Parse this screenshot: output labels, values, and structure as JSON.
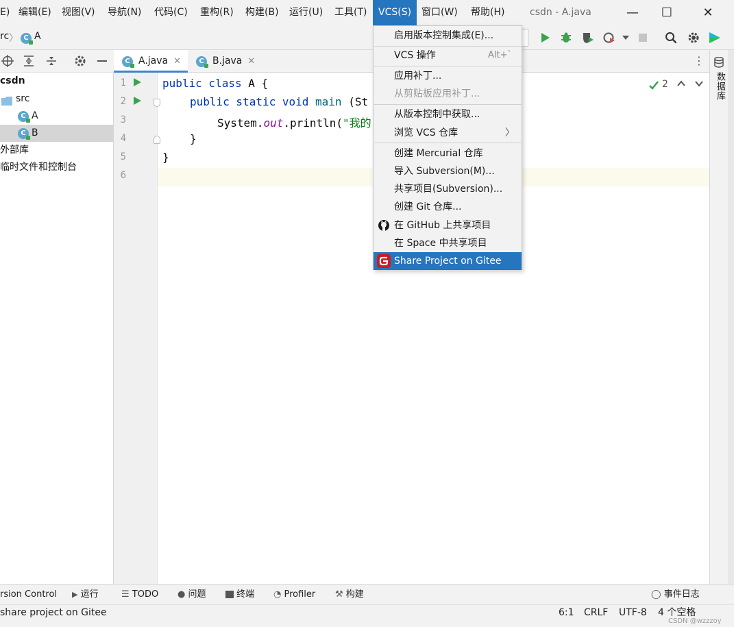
{
  "menubar": {
    "items": [
      "E)",
      "编辑(E)",
      "视图(V)",
      "导航(N)",
      "代码(C)",
      "重构(R)",
      "构建(B)",
      "运行(U)",
      "工具(T)",
      "VCS(S)",
      "窗口(W)",
      "帮助(H)"
    ],
    "active": "VCS(S)"
  },
  "window": {
    "title": "csdn - A.java",
    "minimize": "—",
    "maximize": "☐",
    "close": "✕"
  },
  "navbar": {
    "breadcrumb_prefix": "rc",
    "breadcrumb_sep": "〉",
    "breadcrumb_class": "A"
  },
  "project": {
    "root": "csdn",
    "items": [
      {
        "label": "src",
        "kind": "folder"
      },
      {
        "label": "A",
        "kind": "class"
      },
      {
        "label": "B",
        "kind": "class",
        "selected": true
      },
      {
        "label": "外部库",
        "kind": "library"
      },
      {
        "label": "临时文件和控制台",
        "kind": "scratch"
      }
    ]
  },
  "tabs": [
    {
      "label": "A.java",
      "active": true
    },
    {
      "label": "B.java",
      "active": false
    }
  ],
  "editor": {
    "line_numbers": [
      "1",
      "2",
      "3",
      "4",
      "5",
      "6"
    ],
    "code": {
      "l1_kw": "public class",
      "l1_rest": " A {",
      "l2_kw": "public static void",
      "l2_method": " main",
      "l2_rest": " (St",
      "l3_a": "System.",
      "l3_out": "out",
      "l3_b": ".println(",
      "l3_str": "\"我的",
      "l4": "}",
      "l5": "}"
    },
    "inspection_count": "2"
  },
  "vcs_menu": {
    "items": [
      {
        "label": "启用版本控制集成(E)...",
        "disabled": false
      },
      {
        "label": "VCS 操作",
        "shortcut": "Alt+`",
        "disabled": false
      },
      {
        "label": "应用补丁...",
        "disabled": false
      },
      {
        "label": "从剪贴板应用补丁...",
        "disabled": true
      },
      {
        "label": "从版本控制中获取...",
        "disabled": false
      },
      {
        "label": "浏览 VCS 仓库",
        "submenu": "〉",
        "disabled": false
      },
      {
        "label": "创建 Mercurial 仓库",
        "disabled": false
      },
      {
        "label": "导入 Subversion(M)...",
        "disabled": false
      },
      {
        "label": "共享项目(Subversion)...",
        "disabled": false
      },
      {
        "label": "创建 Git 仓库...",
        "disabled": false
      },
      {
        "label": "在 GitHub 上共享项目",
        "icon": "github-icon",
        "disabled": false
      },
      {
        "label": "在 Space 中共享项目",
        "disabled": false
      },
      {
        "label": "Share Project on Gitee",
        "icon": "gitee-icon",
        "highlighted": true,
        "disabled": false
      }
    ]
  },
  "right_strip": {
    "database_label": "数据库"
  },
  "bottom_tools": {
    "version_control": "rsion Control",
    "run": "运行",
    "todo": "TODO",
    "problems": "问题",
    "terminal": "终端",
    "profiler": "Profiler",
    "build": "构建",
    "event_log": "事件日志"
  },
  "statusbar": {
    "message": "share project on Gitee",
    "position": "6:1",
    "line_sep": "CRLF",
    "encoding": "UTF-8",
    "indent": "4 个空格",
    "watermark": "CSDN @wzzzoy"
  },
  "colors": {
    "accent": "#2675bf",
    "run_green": "#3aa34a",
    "keyword": "#0033b3",
    "string": "#067d17",
    "gitee_red": "#c71d23"
  }
}
